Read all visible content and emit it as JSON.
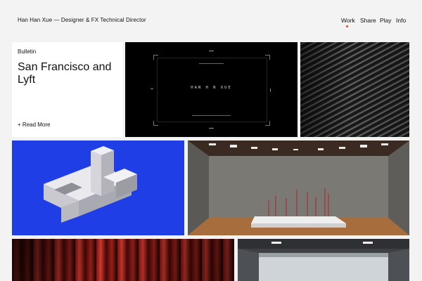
{
  "header": {
    "site_title": "Han Han Xue — Designer & FX Technical Director",
    "nav": [
      {
        "label": "Work",
        "active": true
      },
      {
        "label": "Share"
      },
      {
        "label": "Play"
      },
      {
        "label": "Info"
      }
    ],
    "accent_color": "#e0452b"
  },
  "bulletin": {
    "label": "Bulletin",
    "title": "San Francisco and Lyft",
    "read_more": "+ Read More"
  },
  "tiles": [
    {
      "name": "dark-title-card",
      "logo_text": "HAN H N XUE"
    },
    {
      "name": "wave-stripes-image"
    },
    {
      "name": "blue-3d-letters-image"
    },
    {
      "name": "gallery-installation-image"
    },
    {
      "name": "red-light-streaks-image"
    },
    {
      "name": "architecture-room-image"
    }
  ]
}
